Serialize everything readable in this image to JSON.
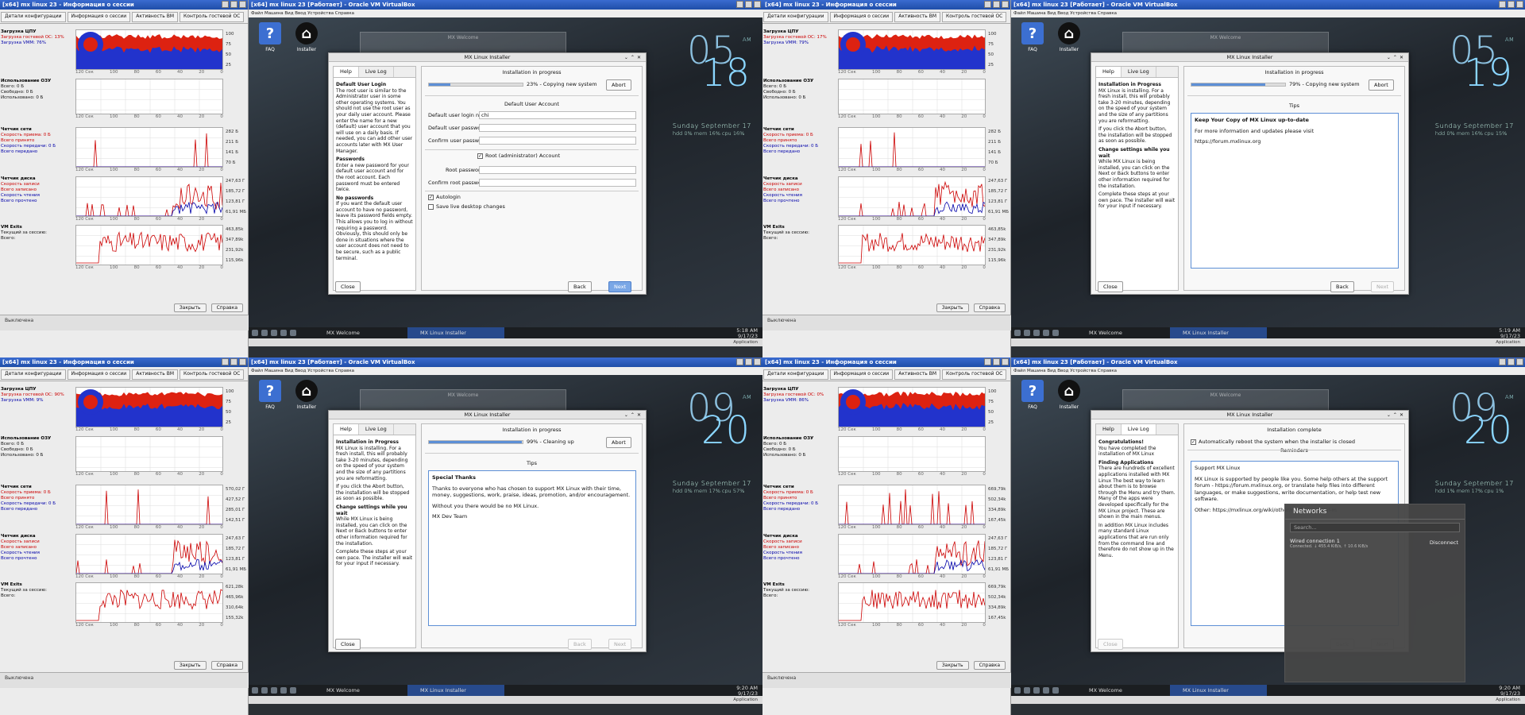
{
  "session_window": {
    "title": "[x64] mx linux 23 - Информация о сессии",
    "tabs": [
      "Детали конфигурации",
      "Информация о сессии",
      "Активность ВМ",
      "Контроль гостевой ОС"
    ],
    "cpu": {
      "heading": "Загрузка ЦПУ",
      "guest": "Загрузка гостевой ОС:",
      "vmm": "Загрузка VMM:"
    },
    "ram": {
      "heading": "Использование ОЗУ",
      "l1": "Всего: 0 Б",
      "l2": "Свободно: 0 Б",
      "l3": "Использовано: 0 Б"
    },
    "net": {
      "heading": "Четчик сети",
      "l1": "Скорость приема: 0 Б",
      "l2": "Всего принято",
      "l3": "Скорость передачи: 0 Б",
      "l4": "Всего передано"
    },
    "disk": {
      "heading": "Четчик диска",
      "l1": "Скорость записи",
      "l2": "Всего записано",
      "l3": "Скорость чтения",
      "l4": "Всего прочтено"
    },
    "vmexits": {
      "heading": "VM Exits",
      "l1": "Текущий за сессию:",
      "l2": "Всего:"
    },
    "x_ticks": [
      "120 Сек",
      "100",
      "80",
      "60",
      "40",
      "20",
      "0"
    ],
    "close_button": "Закрыть",
    "help_button": "Справка",
    "status": "Выключена",
    "quads": [
      {
        "cpu_guest": "13%",
        "cpu_vmm": "76%",
        "net_y": [
          "282 Б",
          "211 Б",
          "141 Б",
          "70 Б"
        ],
        "disk_y": [
          "247,63 Г",
          "185,72 Г",
          "123,81 Г",
          "61,91 МБ"
        ],
        "vm_y": [
          "463,85k",
          "347,89k",
          "231,92k",
          "115,96k"
        ]
      },
      {
        "cpu_guest": "17%",
        "cpu_vmm": "79%",
        "net_y": [
          "282 Б",
          "211 Б",
          "141 Б",
          "70 Б"
        ],
        "disk_y": [
          "247,63 Г",
          "185,72 Г",
          "123,81 Г",
          "61,91 МБ"
        ],
        "vm_y": [
          "463,85k",
          "347,89k",
          "231,92k",
          "115,96k"
        ]
      },
      {
        "cpu_guest": "90%",
        "cpu_vmm": "9%",
        "net_y": [
          "570,02 Г",
          "427,52 Г",
          "285,01 Г",
          "142,51 Г"
        ],
        "disk_y": [
          "247,63 Г",
          "185,72 Г",
          "123,81 Г",
          "61,91 МБ"
        ],
        "vm_y": [
          "621,28k",
          "465,96k",
          "310,64k",
          "155,32k"
        ]
      },
      {
        "cpu_guest": "0%",
        "cpu_vmm": "86%",
        "net_y": [
          "669,79k",
          "502,34k",
          "334,89k",
          "167,45k"
        ],
        "disk_y": [
          "247,63 Г",
          "185,72 Г",
          "123,81 Г",
          "61,91 МБ"
        ],
        "vm_y": [
          "669,79k",
          "502,34k",
          "334,89k",
          "167,45k"
        ]
      }
    ]
  },
  "vm_window": {
    "title": "[x64] mx linux 23 [Работает] - Oracle VM VirtualBox",
    "menu": "Файл   Машина   Вид   Ввод   Устройства   Справка",
    "desktop_icons": [
      {
        "label": "FAQ",
        "glyph": "?"
      },
      {
        "label": "Installer",
        "glyph": "⌂"
      }
    ],
    "ghost_title": "MX Welcome",
    "taskbar": {
      "task1": "MX Welcome",
      "task2": "MX Linux Installer",
      "status_right": "Application"
    }
  },
  "clocks": [
    {
      "hh": "05",
      "mm": "18",
      "ampm": "AM",
      "date": "Sunday  September 17",
      "sys": "hdd 0%  mem 16% cpu 16%",
      "time": "5:18 AM",
      "date_small": "9/17/23"
    },
    {
      "hh": "05",
      "mm": "19",
      "ampm": "AM",
      "date": "Sunday  September 17",
      "sys": "hdd 0%  mem 16% cpu 15%",
      "time": "5:19 AM",
      "date_small": "9/17/23"
    },
    {
      "hh": "09",
      "mm": "20",
      "ampm": "AM",
      "date": "Sunday  September 17",
      "sys": "hdd 0%  mem 17% cpu 57%",
      "time": "9:20 AM",
      "date_small": "9/17/23"
    },
    {
      "hh": "09",
      "mm": "20",
      "ampm": "AM",
      "date": "Sunday  September 17",
      "sys": "hdd 1%  mem 17% cpu 1%",
      "time": "9:20 AM",
      "date_small": "9/17/23"
    }
  ],
  "installer": {
    "title": "MX Linux Installer",
    "tab_help": "Help",
    "tab_log": "Live Log",
    "in_progress": "Installation in progress",
    "complete": "Installation complete",
    "abort": "Abort",
    "close": "Close",
    "back": "Back",
    "next": "Next",
    "tips": "Tips",
    "reminders": "Reminders",
    "q1": {
      "progress_pct": 23,
      "progress_text": "23% - Copying new system",
      "account_header": "Default User Account",
      "login_label": "Default user login name:",
      "login_value": "chi",
      "pass_label": "Default user password:",
      "confirm_label": "Confirm user password:",
      "root_check": "Root (administrator) Account",
      "root_pass": "Root password:",
      "root_confirm": "Confirm root password:",
      "autologin": "Autologin",
      "save_desktop": "Save live desktop changes",
      "help": [
        {
          "h": "Default User Login",
          "t": "The root user is similar to the Administrator user in some other operating systems. You should not use the root user as your daily user account. Please enter the name for a new (default) user account that you will use on a daily basis. If needed, you can add other user accounts later with MX User Manager."
        },
        {
          "h": "Passwords",
          "t": "Enter a new password for your default user account and for the root account. Each password must be entered twice."
        },
        {
          "h": "No passwords",
          "t": "If you want the default user account to have no password, leave its password fields empty. This allows you to log in without requiring a password. Obviously, this should only be done in situations where the user account does not need to be secure, such as a public terminal."
        }
      ]
    },
    "q2": {
      "progress_pct": 79,
      "progress_text": "79% - Copying new system",
      "tip_head": "Keep Your Copy of MX Linux up-to-date",
      "tip_l1": "For more information and updates please visit",
      "tip_l2": "https://forum.mxlinux.org"
    },
    "progress_help": [
      {
        "h": "Installation in Progress",
        "t": "MX Linux is installing. For a fresh install, this will probably take 3-20 minutes, depending on the speed of your system and the size of any partitions you are reformatting."
      },
      {
        "h": "",
        "t": "If you click the Abort button, the installation will be stopped as soon as possible."
      },
      {
        "h": "Change settings while you wait",
        "t": "While MX Linux is being installed, you can click on the Next or Back buttons to enter other information required for the installation."
      },
      {
        "h": "",
        "t": "Complete these steps at your own pace. The installer will wait for your input if necessary."
      }
    ],
    "q3": {
      "progress_pct": 99,
      "progress_text": "99% - Cleaning up",
      "tip_head": "Special Thanks",
      "tip_l1": "Thanks to everyone who has chosen to support MX Linux with their time, money, suggestions, work, praise, ideas, promotion, and/or encouragement.",
      "tip_l2": "Without you there would be no MX Linux.",
      "tip_l3": "MX Dev Team"
    },
    "q4": {
      "auto_reboot": "Automatically reboot the system when the installer is closed",
      "rem_head": "Support MX Linux",
      "rem_l1": "MX Linux is supported by people like you. Some help others at the support forum - https://forum.mxlinux.org, or translate help files into different languages, or make suggestions, write documentation, or help test new software.",
      "rem_l2": "Other: https://mxlinux.org/wiki/other/mx-linux-social-m",
      "help": [
        {
          "h": "Congratulations!",
          "t": "You have completed the installation of MX Linux"
        },
        {
          "h": "Finding Applications",
          "t": "There are hundreds of excellent applications installed with MX Linux The best way to learn about them is to browse through the Menu and try them. Many of the apps were developed specifically for the MX Linux project. These are shown in the main menus."
        },
        {
          "h": "",
          "t": "In addition MX Linux includes many standard Linux applications that are run only from the command line and therefore do not show up in the Menu."
        }
      ]
    }
  },
  "networks": {
    "title": "Networks",
    "search_placeholder": "Search...",
    "conn_name": "Wired connection 1",
    "conn_status": "Connected. ↓ 455.4 KiB/s, ↑ 10.6 KiB/s",
    "disconnect": "Disconnect"
  }
}
